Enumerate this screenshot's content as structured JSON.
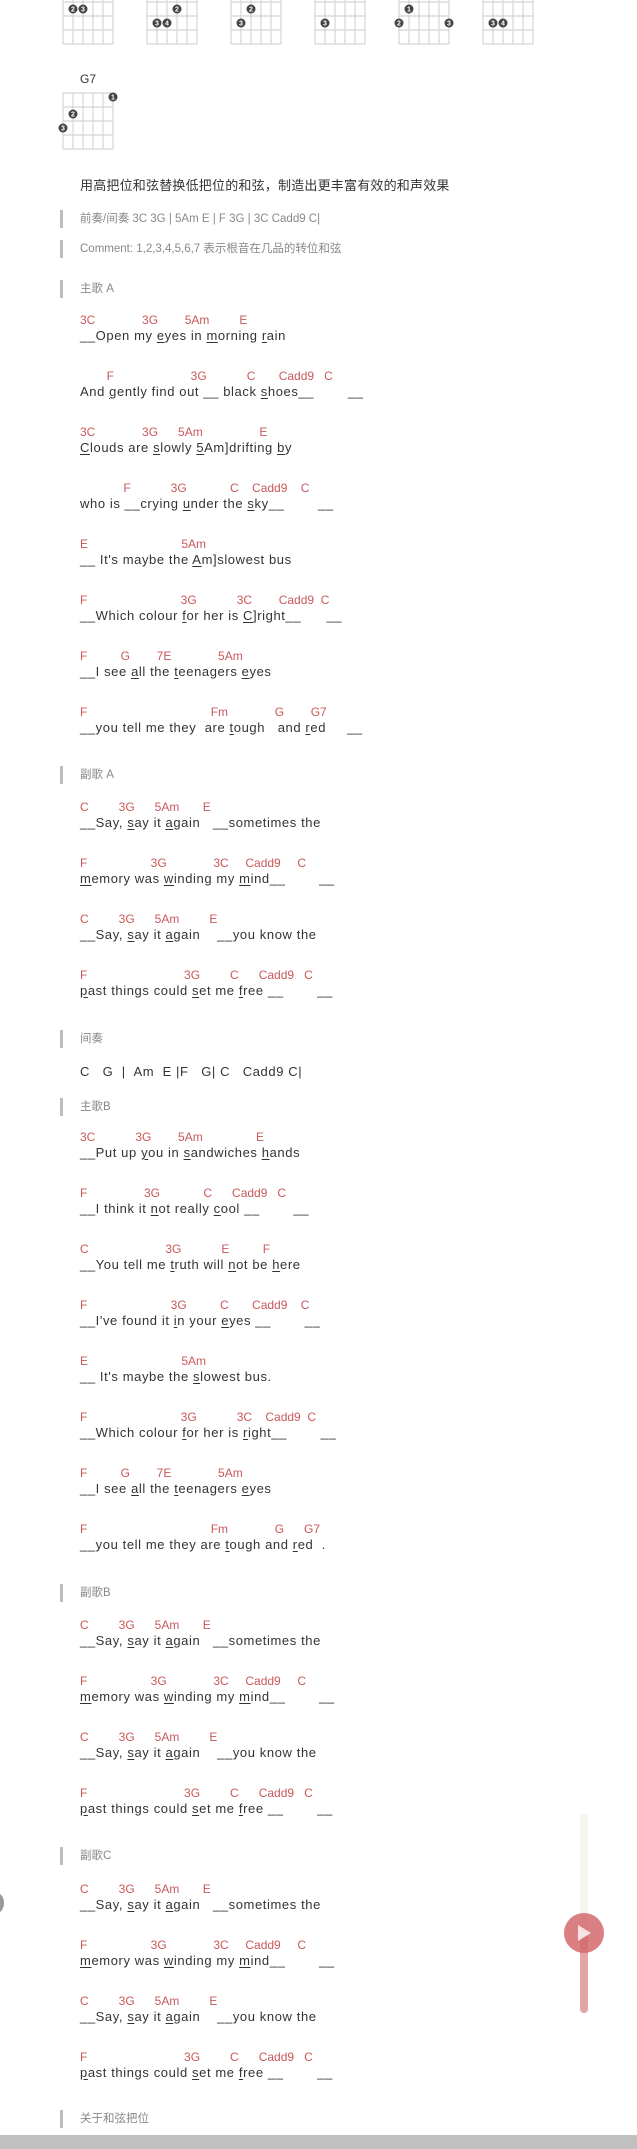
{
  "chord_diagrams": [
    {
      "name": "",
      "barre": false,
      "muted_top": false,
      "dots": [
        {
          "s": 4,
          "f": 1,
          "n": "1"
        },
        {
          "s": 1,
          "f": 2,
          "n": "2"
        },
        {
          "s": 2,
          "f": 2,
          "n": "3"
        }
      ]
    },
    {
      "name": "",
      "barre": true,
      "muted_top": false,
      "dots": [
        {
          "s": 2.5,
          "f": 1,
          "n": "1"
        },
        {
          "s": 3,
          "f": 2,
          "n": "2"
        },
        {
          "s": 1,
          "f": 3,
          "n": "3"
        },
        {
          "s": 2,
          "f": 3,
          "n": "4"
        }
      ]
    },
    {
      "name": "",
      "barre": false,
      "muted_top": true,
      "dots": [
        {
          "s": 4,
          "f": 1,
          "n": "1"
        },
        {
          "s": 2,
          "f": 2,
          "n": "2"
        },
        {
          "s": 1,
          "f": 3,
          "n": "3"
        }
      ]
    },
    {
      "name": "",
      "barre": false,
      "muted_top": true,
      "dots": [
        {
          "s": 4,
          "f": 1,
          "n": "1"
        },
        {
          "s": 1,
          "f": 3,
          "n": "3"
        }
      ]
    },
    {
      "name": "",
      "barre": false,
      "muted_top": false,
      "dots": [
        {
          "s": 1,
          "f": 2,
          "n": "1"
        },
        {
          "s": 0,
          "f": 3,
          "n": "2"
        },
        {
          "s": 5,
          "f": 3,
          "n": "3"
        }
      ]
    },
    {
      "name": "",
      "barre": true,
      "muted_top": false,
      "dots": [
        {
          "s": 2.5,
          "f": 1,
          "n": "1"
        },
        {
          "s": 1,
          "f": 3,
          "n": "3"
        },
        {
          "s": 2,
          "f": 3,
          "n": "4"
        }
      ]
    },
    {
      "name": "G7",
      "barre": false,
      "muted_top": false,
      "dots": [
        {
          "s": 5,
          "f": 1,
          "n": "1"
        },
        {
          "s": 1,
          "f": 2,
          "n": "2"
        },
        {
          "s": 0,
          "f": 3,
          "n": "3"
        }
      ]
    }
  ],
  "intro_text": "用高把位和弦替换低把位的和弦，制造出更丰富有效的和声效果",
  "prelude": "前奏/间奏 3C 3G | 5Am E | F 3G | 3C Cadd9 C|",
  "comment": "Comment: 1,2,3,4,5,6,7 表示根音在几品的转位和弦",
  "sections": [
    {
      "title": "主歌 A",
      "lines": [
        {
          "chords": "3C              3G        5Am         E",
          "lyric": "__Open my eyes in morning rain",
          "u": [
            "eyes",
            "morning",
            "rain"
          ]
        },
        {
          "chords": "        F                       3G            C       Cadd9   C",
          "lyric": "And gently find out __ black shoes__        __",
          "u": [
            "gently",
            "shoes"
          ]
        },
        {
          "chords": "3C              3G      5Am                 E",
          "lyric": "Clouds are slowly 5Am]drifting by",
          "u": [
            "Clouds",
            "slowly",
            "5Am]drifting",
            "by"
          ]
        },
        {
          "chords": "             F            3G             C    Cadd9    C",
          "lyric": "who is __crying under the sky__        __",
          "u": [
            "under",
            "sky"
          ]
        },
        {
          "chords": "E                            5Am",
          "lyric": "__ It's maybe the Am]slowest bus",
          "u": [
            "Am]slowest"
          ]
        },
        {
          "chords": "F                            3G            3C        Cadd9  C",
          "lyric": "__Which colour for her is C]right__      __",
          "u": [
            "for",
            "C]right"
          ]
        },
        {
          "chords": "F          G        7E              5Am",
          "lyric": "__I see all the teenagers eyes",
          "u": [
            "all",
            "teenagers",
            "eyes"
          ]
        },
        {
          "chords": "F                                     Fm              G        G7",
          "lyric": "__you tell me they  are tough   and red     __",
          "u": [
            "tough",
            "red"
          ]
        }
      ]
    },
    {
      "title": "副歌 A",
      "lines": [
        {
          "chords": "C         3G      5Am       E",
          "lyric": "__Say, say it again   __sometimes the",
          "u": [
            "say",
            "again"
          ]
        },
        {
          "chords": "F                   3G              3C     Cadd9     C",
          "lyric": "memory was winding my mind__        __",
          "u": [
            "memory",
            "winding",
            "mind"
          ]
        },
        {
          "chords": "C         3G      5Am         E",
          "lyric": "__Say, say it again    __you know the",
          "u": [
            "say",
            "again"
          ]
        },
        {
          "chords": "F                             3G         C      Cadd9   C",
          "lyric": "past things could set me free __        __",
          "u": [
            "past",
            "set",
            "free"
          ]
        }
      ]
    },
    {
      "title": "间奏",
      "plain": "C   G  |  Am  E |F   G| C   Cadd9 C|"
    },
    {
      "title": "主歌B",
      "lines": [
        {
          "chords": "3C            3G        5Am                E",
          "lyric": "__Put up you in sandwiches hands",
          "u": [
            "you",
            "sandwiches",
            "hands"
          ]
        },
        {
          "chords": "F                 3G             C      Cadd9   C",
          "lyric": "__I think it not really cool __        __",
          "u": [
            "not",
            "cool"
          ]
        },
        {
          "chords": "C                       3G            E          F",
          "lyric": "__You tell me truth will not be here",
          "u": [
            "truth",
            "not",
            "here"
          ]
        },
        {
          "chords": "F                         3G          C       Cadd9    C",
          "lyric": "__I've found it in your eyes __        __",
          "u": [
            "in",
            "eyes"
          ]
        },
        {
          "chords": "E                            5Am",
          "lyric": "__ It's maybe the slowest bus.",
          "u": [
            "slowest"
          ]
        },
        {
          "chords": "F                            3G            3C    Cadd9  C",
          "lyric": "__Which colour for her is right__        __",
          "u": [
            "for",
            "right"
          ]
        },
        {
          "chords": "F          G        7E              5Am",
          "lyric": "__I see all the teenagers eyes",
          "u": [
            "all",
            "teenagers",
            "eyes"
          ]
        },
        {
          "chords": "F                                     Fm              G      G7",
          "lyric": "__you tell me they are tough and red  .",
          "u": [
            "tough",
            "red"
          ]
        }
      ]
    },
    {
      "title": "副歌B",
      "lines": [
        {
          "chords": "C         3G      5Am       E",
          "lyric": "__Say, say it again   __sometimes the",
          "u": [
            "say",
            "again"
          ]
        },
        {
          "chords": "F                   3G              3C     Cadd9     C",
          "lyric": "memory was winding my mind__        __",
          "u": [
            "memory",
            "winding",
            "mind"
          ]
        },
        {
          "chords": "C         3G      5Am         E",
          "lyric": "__Say, say it again    __you know the",
          "u": [
            "say",
            "again"
          ]
        },
        {
          "chords": "F                             3G         C      Cadd9   C",
          "lyric": "past things could set me free __        __",
          "u": [
            "past",
            "set",
            "free"
          ]
        }
      ]
    },
    {
      "title": "副歌C",
      "lines": [
        {
          "chords": "C         3G      5Am       E",
          "lyric": "__Say, say it again   __sometimes the",
          "u": [
            "say",
            "again"
          ]
        },
        {
          "chords": "F                   3G              3C     Cadd9     C",
          "lyric": "memory was winding my mind__        __",
          "u": [
            "memory",
            "winding",
            "mind"
          ]
        },
        {
          "chords": "C         3G      5Am         E",
          "lyric": "__Say, say it again    __you know the",
          "u": [
            "say",
            "again"
          ]
        },
        {
          "chords": "F                             3G         C      Cadd9   C",
          "lyric": "past things could set me free __        __",
          "u": [
            "past",
            "set",
            "free"
          ]
        }
      ]
    },
    {
      "title": "关于和弦把位"
    }
  ],
  "player": {
    "play_icon": "play-icon",
    "progress_fraction": 0.6
  },
  "colors": {
    "chord": "#c9585a",
    "lyric": "#333333",
    "meta": "#888888",
    "quote_bar": "#bdbdbd",
    "player_accent": "#d3696c"
  }
}
